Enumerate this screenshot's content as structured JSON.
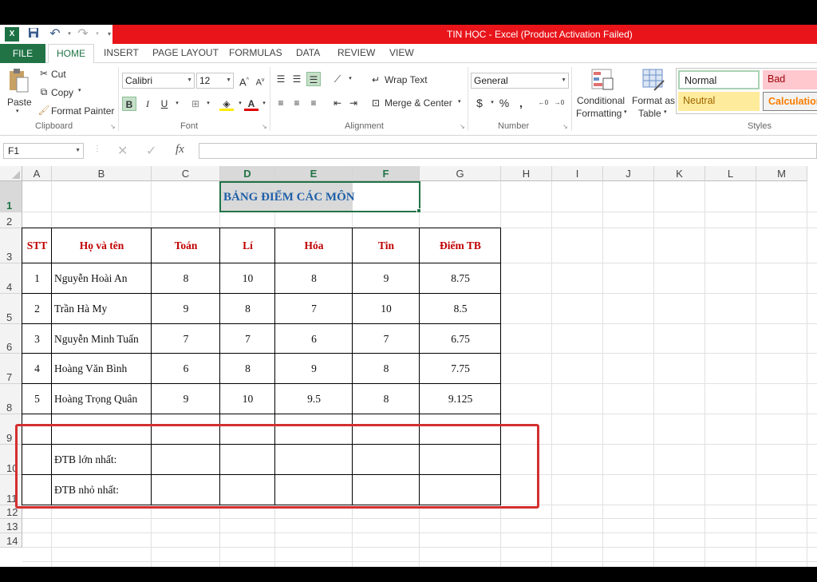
{
  "window": {
    "title": "TIN HỌC -  Excel (Product Activation Failed)",
    "accent": "#217346",
    "titlebar_color": "#e8141a"
  },
  "tabs": [
    "FILE",
    "HOME",
    "INSERT",
    "PAGE LAYOUT",
    "FORMULAS",
    "DATA",
    "REVIEW",
    "VIEW"
  ],
  "ribbon": {
    "clipboard": {
      "paste": "Paste",
      "cut": "Cut",
      "copy": "Copy",
      "format_painter": "Format Painter",
      "label": "Clipboard"
    },
    "font": {
      "name": "Calibri",
      "size": "12",
      "bold": "B",
      "italic": "I",
      "underline": "U",
      "label": "Font"
    },
    "alignment": {
      "wrap_text": "Wrap Text",
      "merge_center": "Merge & Center",
      "label": "Alignment"
    },
    "number": {
      "format": "General",
      "currency": "$",
      "percent": "%",
      "comma": ",",
      "label": "Number"
    },
    "styles": {
      "conditional_1": "Conditional",
      "conditional_2": "Formatting",
      "table_1": "Format as",
      "table_2": "Table",
      "normal": "Normal",
      "bad": "Bad",
      "neutral": "Neutral",
      "calculation": "Calculation",
      "label": "Styles"
    }
  },
  "formula_bar": {
    "name_box": "F1",
    "fx": "fx",
    "value": ""
  },
  "columns": [
    "A",
    "B",
    "C",
    "D",
    "E",
    "F",
    "G",
    "H",
    "I",
    "J",
    "K",
    "L",
    "M"
  ],
  "rows": [
    "1",
    "2",
    "3",
    "4",
    "5",
    "6",
    "7",
    "8",
    "9",
    "10",
    "11",
    "12",
    "13",
    "14"
  ],
  "sheet": {
    "title": "BẢNG ĐIỂM CÁC MÔN",
    "headers": [
      "STT",
      "Họ và tên",
      "Toán",
      "Lí",
      "Hóa",
      "Tin",
      "Điểm TB"
    ],
    "students": [
      [
        "1",
        "Nguyễn Hoài An",
        "8",
        "10",
        "8",
        "9",
        "8.75"
      ],
      [
        "2",
        "Trần Hà My",
        "9",
        "8",
        "7",
        "10",
        "8.5"
      ],
      [
        "3",
        "Nguyễn Minh Tuấn",
        "7",
        "7",
        "6",
        "7",
        "6.75"
      ],
      [
        "4",
        "Hoàng Văn Bình",
        "6",
        "8",
        "9",
        "8",
        "7.75"
      ],
      [
        "5",
        "Hoàng Trọng Quân",
        "9",
        "10",
        "9.5",
        "8",
        "9.125"
      ]
    ],
    "dtb_max_label": "ĐTB lớn nhất:",
    "dtb_min_label": "ĐTB nhỏ nhất:",
    "highlight_color": "#d32f2f"
  }
}
